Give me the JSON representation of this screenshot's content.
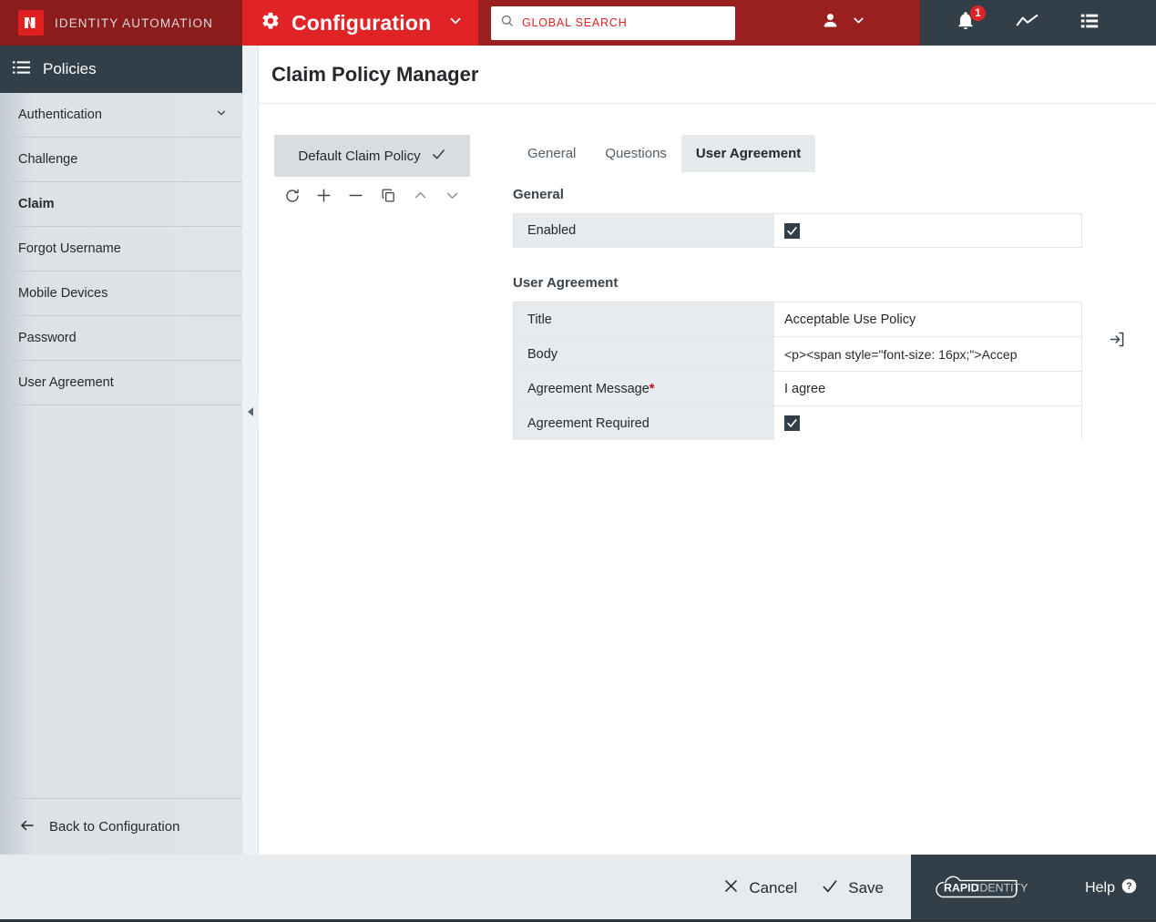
{
  "topbar": {
    "brand_name": "IDENTITY AUTOMATION",
    "brand_logo_icon": "identity-automation-logo-icon",
    "config_title": "Configuration",
    "config_gear_icon": "gear-icon",
    "config_caret_icon": "chevron-down-icon",
    "search": {
      "icon": "search-icon",
      "value": "",
      "placeholder": "GLOBAL SEARCH"
    },
    "user_icon": "user-icon",
    "user_caret_icon": "chevron-down-icon",
    "notifications": {
      "icon": "bell-icon",
      "count": "1"
    },
    "analytics_icon": "trend-line-icon",
    "list_icon": "list-view-icon",
    "colors": {
      "brand_bg": "#8c1c1c",
      "config_bg": "#e02425",
      "mid_bg": "#9a2020",
      "right_bg": "#323e48",
      "badge": "#e02425",
      "search_placeholder": "#e02425"
    }
  },
  "sidebar": {
    "header_icon": "list-icon",
    "header_label": "Policies",
    "items": [
      {
        "label": "Authentication",
        "active": false,
        "has_caret": true,
        "caret_icon": "chevron-down-icon"
      },
      {
        "label": "Challenge",
        "active": false,
        "has_caret": false
      },
      {
        "label": "Claim",
        "active": true,
        "has_caret": false
      },
      {
        "label": "Forgot Username",
        "active": false,
        "has_caret": false
      },
      {
        "label": "Mobile Devices",
        "active": false,
        "has_caret": false
      },
      {
        "label": "Password",
        "active": false,
        "has_caret": false
      },
      {
        "label": "User Agreement",
        "active": false,
        "has_caret": false
      }
    ],
    "back_icon": "arrow-left-icon",
    "back_label": "Back to Configuration",
    "collapse_icon": "triangle-left-icon"
  },
  "main": {
    "page_title": "Claim Policy Manager",
    "policy_list": {
      "items": [
        {
          "label": "Default Claim Policy",
          "selected": true,
          "check_icon": "check-icon"
        }
      ],
      "toolbar": [
        {
          "name": "refresh-button",
          "icon": "refresh-icon"
        },
        {
          "name": "add-button",
          "icon": "plus-icon"
        },
        {
          "name": "remove-button",
          "icon": "minus-icon"
        },
        {
          "name": "copy-button",
          "icon": "copy-icon"
        },
        {
          "name": "move-up-button",
          "icon": "chevron-up-icon"
        },
        {
          "name": "move-down-button",
          "icon": "chevron-down-icon"
        }
      ]
    },
    "tabs": [
      {
        "label": "General",
        "active": false
      },
      {
        "label": "Questions",
        "active": false
      },
      {
        "label": "User Agreement",
        "active": true
      }
    ],
    "sections": [
      {
        "heading": "General",
        "rows": [
          {
            "label": "Enabled",
            "required": false,
            "type": "checkbox",
            "checked": true,
            "value": ""
          }
        ]
      },
      {
        "heading": "User Agreement",
        "rows": [
          {
            "label": "Title",
            "required": false,
            "type": "text",
            "value": "Acceptable Use Policy"
          },
          {
            "label": "Body",
            "required": false,
            "type": "text",
            "value": "<p><span style=\"font-size: 16px;\">Accep",
            "expand_icon": "open-editor-icon"
          },
          {
            "label": "Agreement Message",
            "required": true,
            "type": "text",
            "value": "I agree"
          },
          {
            "label": "Agreement Required",
            "required": false,
            "type": "checkbox",
            "checked": true,
            "value": ""
          }
        ]
      }
    ]
  },
  "footer": {
    "cancel_label": "Cancel",
    "cancel_icon": "close-x-icon",
    "save_label": "Save",
    "save_icon": "check-icon",
    "product_logo_bold": "RAPID",
    "product_logo_light": "IDENTITY",
    "product_logo_icon": "cloud-icon",
    "help_label": "Help",
    "help_icon": "question-circle-icon"
  }
}
